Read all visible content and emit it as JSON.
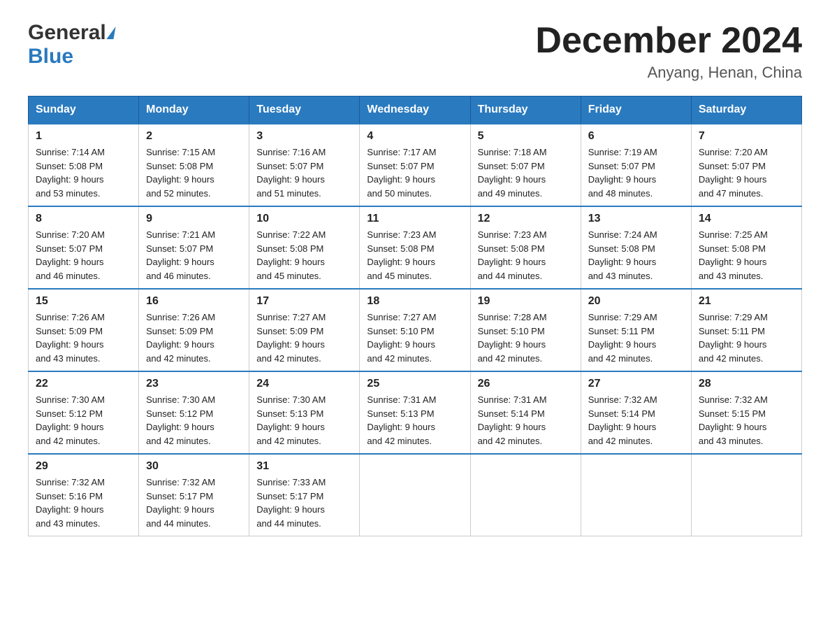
{
  "header": {
    "logo_general": "General",
    "logo_blue": "Blue",
    "title": "December 2024",
    "subtitle": "Anyang, Henan, China"
  },
  "days_of_week": [
    "Sunday",
    "Monday",
    "Tuesday",
    "Wednesday",
    "Thursday",
    "Friday",
    "Saturday"
  ],
  "weeks": [
    [
      {
        "day": "1",
        "sunrise": "7:14 AM",
        "sunset": "5:08 PM",
        "daylight": "9 hours and 53 minutes."
      },
      {
        "day": "2",
        "sunrise": "7:15 AM",
        "sunset": "5:08 PM",
        "daylight": "9 hours and 52 minutes."
      },
      {
        "day": "3",
        "sunrise": "7:16 AM",
        "sunset": "5:07 PM",
        "daylight": "9 hours and 51 minutes."
      },
      {
        "day": "4",
        "sunrise": "7:17 AM",
        "sunset": "5:07 PM",
        "daylight": "9 hours and 50 minutes."
      },
      {
        "day": "5",
        "sunrise": "7:18 AM",
        "sunset": "5:07 PM",
        "daylight": "9 hours and 49 minutes."
      },
      {
        "day": "6",
        "sunrise": "7:19 AM",
        "sunset": "5:07 PM",
        "daylight": "9 hours and 48 minutes."
      },
      {
        "day": "7",
        "sunrise": "7:20 AM",
        "sunset": "5:07 PM",
        "daylight": "9 hours and 47 minutes."
      }
    ],
    [
      {
        "day": "8",
        "sunrise": "7:20 AM",
        "sunset": "5:07 PM",
        "daylight": "9 hours and 46 minutes."
      },
      {
        "day": "9",
        "sunrise": "7:21 AM",
        "sunset": "5:07 PM",
        "daylight": "9 hours and 46 minutes."
      },
      {
        "day": "10",
        "sunrise": "7:22 AM",
        "sunset": "5:08 PM",
        "daylight": "9 hours and 45 minutes."
      },
      {
        "day": "11",
        "sunrise": "7:23 AM",
        "sunset": "5:08 PM",
        "daylight": "9 hours and 45 minutes."
      },
      {
        "day": "12",
        "sunrise": "7:23 AM",
        "sunset": "5:08 PM",
        "daylight": "9 hours and 44 minutes."
      },
      {
        "day": "13",
        "sunrise": "7:24 AM",
        "sunset": "5:08 PM",
        "daylight": "9 hours and 43 minutes."
      },
      {
        "day": "14",
        "sunrise": "7:25 AM",
        "sunset": "5:08 PM",
        "daylight": "9 hours and 43 minutes."
      }
    ],
    [
      {
        "day": "15",
        "sunrise": "7:26 AM",
        "sunset": "5:09 PM",
        "daylight": "9 hours and 43 minutes."
      },
      {
        "day": "16",
        "sunrise": "7:26 AM",
        "sunset": "5:09 PM",
        "daylight": "9 hours and 42 minutes."
      },
      {
        "day": "17",
        "sunrise": "7:27 AM",
        "sunset": "5:09 PM",
        "daylight": "9 hours and 42 minutes."
      },
      {
        "day": "18",
        "sunrise": "7:27 AM",
        "sunset": "5:10 PM",
        "daylight": "9 hours and 42 minutes."
      },
      {
        "day": "19",
        "sunrise": "7:28 AM",
        "sunset": "5:10 PM",
        "daylight": "9 hours and 42 minutes."
      },
      {
        "day": "20",
        "sunrise": "7:29 AM",
        "sunset": "5:11 PM",
        "daylight": "9 hours and 42 minutes."
      },
      {
        "day": "21",
        "sunrise": "7:29 AM",
        "sunset": "5:11 PM",
        "daylight": "9 hours and 42 minutes."
      }
    ],
    [
      {
        "day": "22",
        "sunrise": "7:30 AM",
        "sunset": "5:12 PM",
        "daylight": "9 hours and 42 minutes."
      },
      {
        "day": "23",
        "sunrise": "7:30 AM",
        "sunset": "5:12 PM",
        "daylight": "9 hours and 42 minutes."
      },
      {
        "day": "24",
        "sunrise": "7:30 AM",
        "sunset": "5:13 PM",
        "daylight": "9 hours and 42 minutes."
      },
      {
        "day": "25",
        "sunrise": "7:31 AM",
        "sunset": "5:13 PM",
        "daylight": "9 hours and 42 minutes."
      },
      {
        "day": "26",
        "sunrise": "7:31 AM",
        "sunset": "5:14 PM",
        "daylight": "9 hours and 42 minutes."
      },
      {
        "day": "27",
        "sunrise": "7:32 AM",
        "sunset": "5:14 PM",
        "daylight": "9 hours and 42 minutes."
      },
      {
        "day": "28",
        "sunrise": "7:32 AM",
        "sunset": "5:15 PM",
        "daylight": "9 hours and 43 minutes."
      }
    ],
    [
      {
        "day": "29",
        "sunrise": "7:32 AM",
        "sunset": "5:16 PM",
        "daylight": "9 hours and 43 minutes."
      },
      {
        "day": "30",
        "sunrise": "7:32 AM",
        "sunset": "5:17 PM",
        "daylight": "9 hours and 44 minutes."
      },
      {
        "day": "31",
        "sunrise": "7:33 AM",
        "sunset": "5:17 PM",
        "daylight": "9 hours and 44 minutes."
      },
      null,
      null,
      null,
      null
    ]
  ],
  "labels": {
    "sunrise": "Sunrise:",
    "sunset": "Sunset:",
    "daylight": "Daylight:"
  }
}
